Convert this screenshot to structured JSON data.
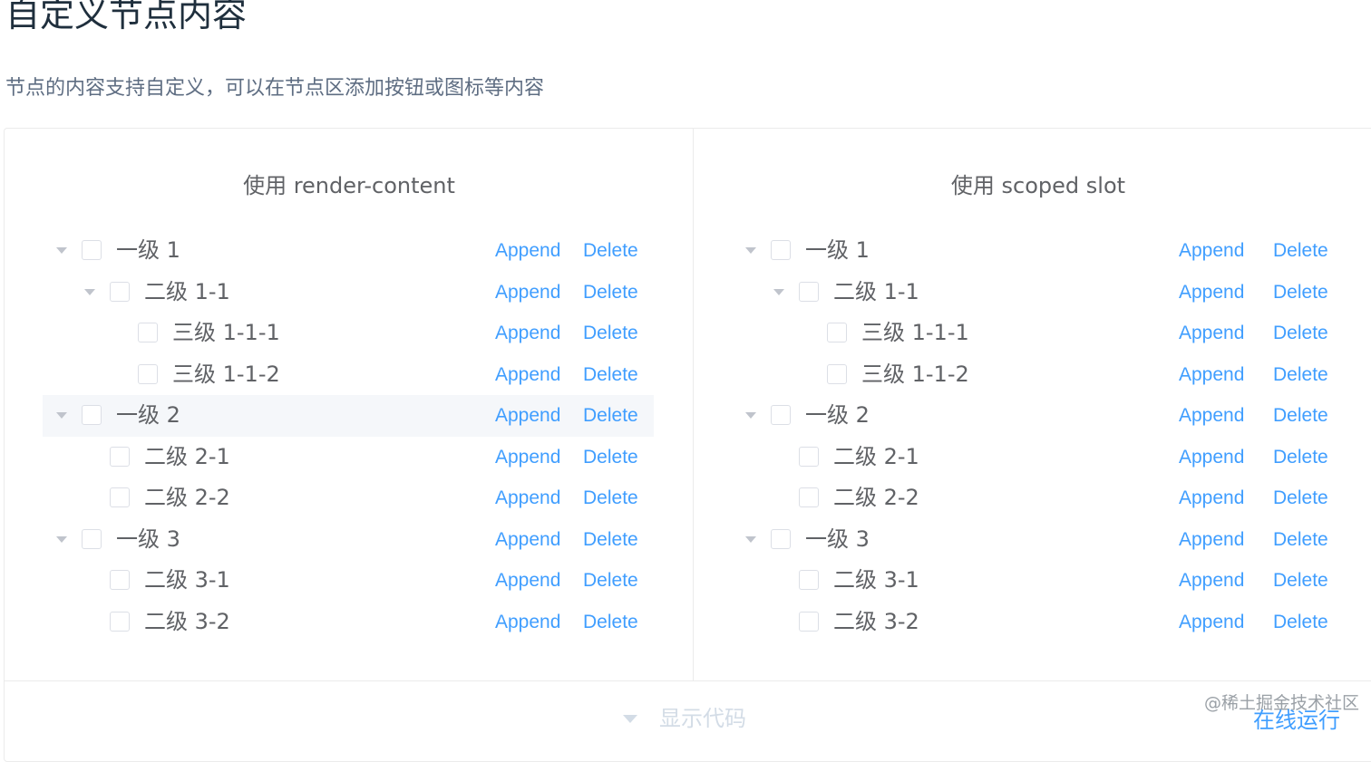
{
  "page": {
    "title": "自定义节点内容",
    "description": "节点的内容支持自定义，可以在节点区添加按钮或图标等内容"
  },
  "panels": [
    {
      "title": "使用 render-content"
    },
    {
      "title": "使用 scoped slot"
    }
  ],
  "tree_nodes": [
    {
      "label": "一级 1",
      "level": 1,
      "expandable": true
    },
    {
      "label": "二级 1-1",
      "level": 2,
      "expandable": true
    },
    {
      "label": "三级 1-1-1",
      "level": 3,
      "expandable": false
    },
    {
      "label": "三级 1-1-2",
      "level": 3,
      "expandable": false
    },
    {
      "label": "一级 2",
      "level": 1,
      "expandable": true
    },
    {
      "label": "二级 2-1",
      "level": 2,
      "expandable": false
    },
    {
      "label": "二级 2-2",
      "level": 2,
      "expandable": false
    },
    {
      "label": "一级 3",
      "level": 1,
      "expandable": true
    },
    {
      "label": "二级 3-1",
      "level": 2,
      "expandable": false
    },
    {
      "label": "二级 3-2",
      "level": 2,
      "expandable": false
    }
  ],
  "actions": {
    "append": "Append",
    "delete": "Delete"
  },
  "footer": {
    "toggle_label": "显示代码",
    "run_label": "在线运行",
    "watermark": "@稀土掘金技术社区"
  },
  "colors": {
    "link": "#409eff",
    "text": "#606266",
    "hover_row": "#f5f7fa"
  }
}
